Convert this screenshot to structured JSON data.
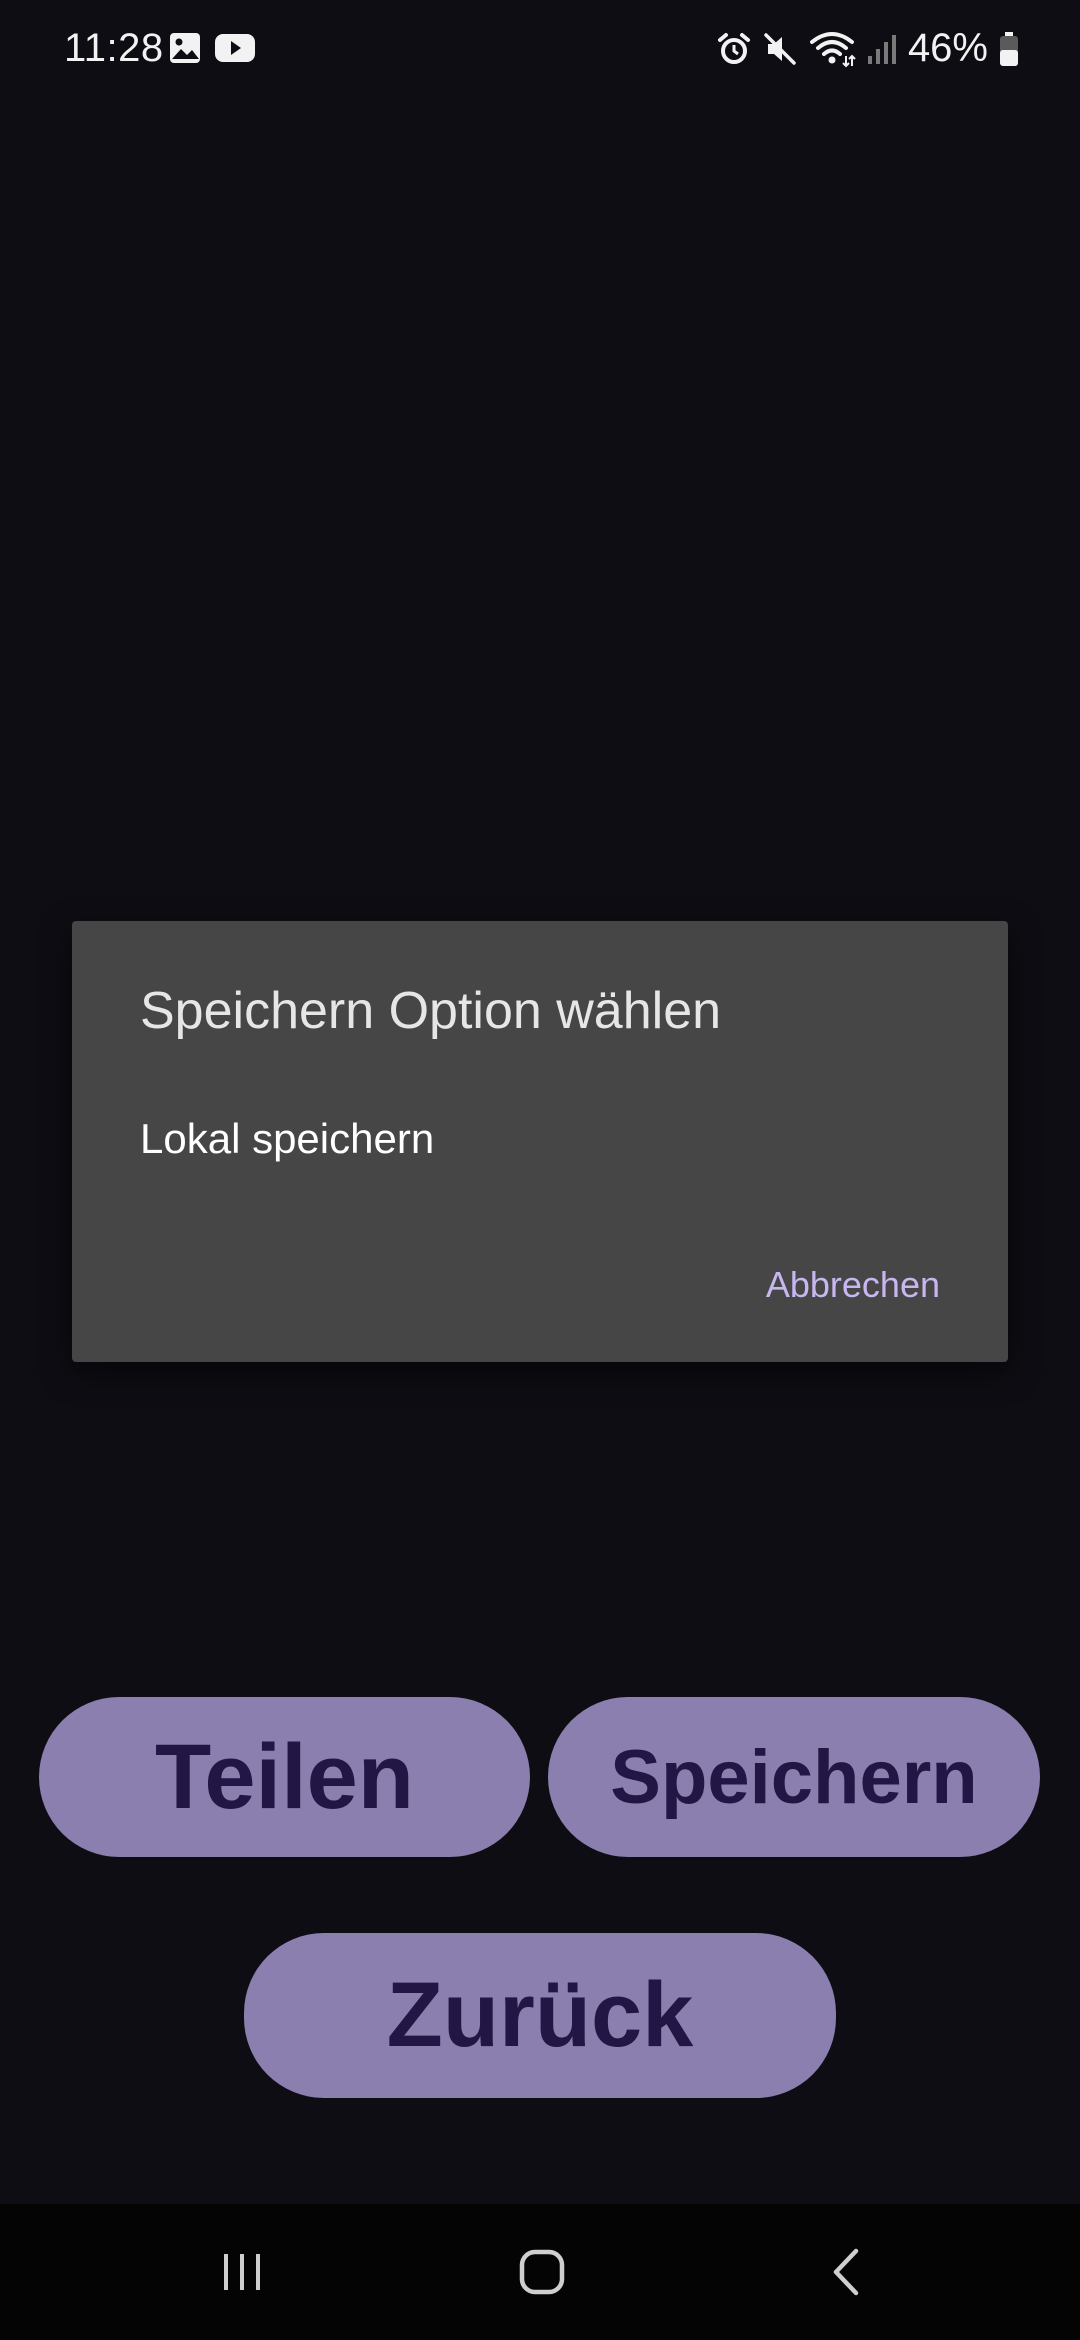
{
  "status_bar": {
    "time": "11:28",
    "left_icons": [
      "gallery-icon",
      "youtube-icon"
    ],
    "right_icons": [
      "alarm-icon",
      "mute-icon",
      "wifi-icon",
      "signal-icon",
      "battery-icon"
    ],
    "battery_percent": "46%"
  },
  "dialog": {
    "title": "Speichern Option wählen",
    "option": "Lokal speichern",
    "cancel_label": "Abbrechen"
  },
  "buttons": {
    "share_label": "Teilen",
    "save_label": "Speichern",
    "back_label": "Zurück"
  },
  "nav_bar": {
    "icons": [
      "recents-icon",
      "home-icon",
      "back-icon"
    ]
  },
  "colors": {
    "background": "#0e0d13",
    "dialog_bg": "#464646",
    "accent_text": "#c8b6f0",
    "button_bg": "#8a7fae",
    "button_text": "#221645"
  }
}
